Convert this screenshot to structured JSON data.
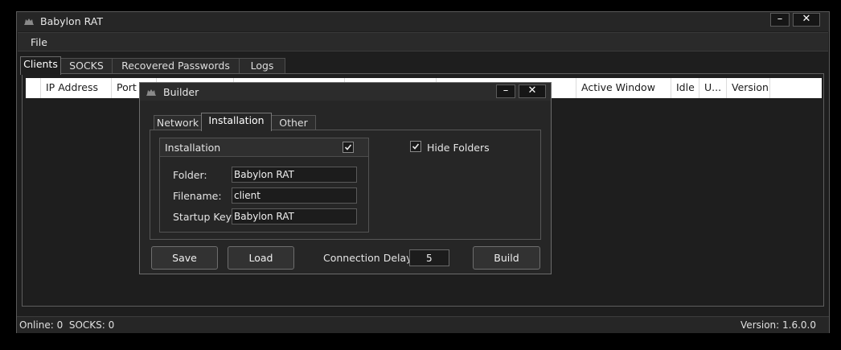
{
  "app": {
    "title": "Babylon RAT",
    "icon": "hat-icon",
    "minimize_glyph": "–",
    "close_glyph": "✕"
  },
  "menu": {
    "file_label": "File"
  },
  "tabs": [
    "Clients",
    "SOCKS",
    "Recovered Passwords",
    "Logs"
  ],
  "active_tab": "Clients",
  "grid": {
    "columns": [
      "",
      "IP Address",
      "Port",
      "",
      "",
      "",
      "",
      "Active Window",
      "Idle",
      "U...",
      "Version"
    ],
    "rows": []
  },
  "status": {
    "left": "Online: 0  SOCKS: 0",
    "right": "Version: 1.6.0.0"
  },
  "builder": {
    "title": "Builder",
    "tabs": [
      "Network",
      "Installation",
      "Other"
    ],
    "active_tab": "Installation",
    "installation": {
      "header": "Installation",
      "enabled": true,
      "folder_label": "Folder:",
      "folder_value": "Babylon RAT",
      "filename_label": "Filename:",
      "filename_value": "client",
      "startup_key_label": "Startup Key:",
      "startup_key_value": "Babylon RAT"
    },
    "hide_folders": {
      "label": "Hide Folders",
      "checked": true
    },
    "buttons": {
      "save": "Save",
      "load": "Load",
      "build": "Build"
    },
    "connection_delay": {
      "label": "Connection Delay:",
      "value": "5"
    }
  },
  "colors": {
    "window_bg": "#1e1e1e",
    "titlebar_bg": "#262626",
    "grid_header_bg": "#ffffff",
    "text": "#dcdcdc",
    "border": "#5a5a5a"
  }
}
